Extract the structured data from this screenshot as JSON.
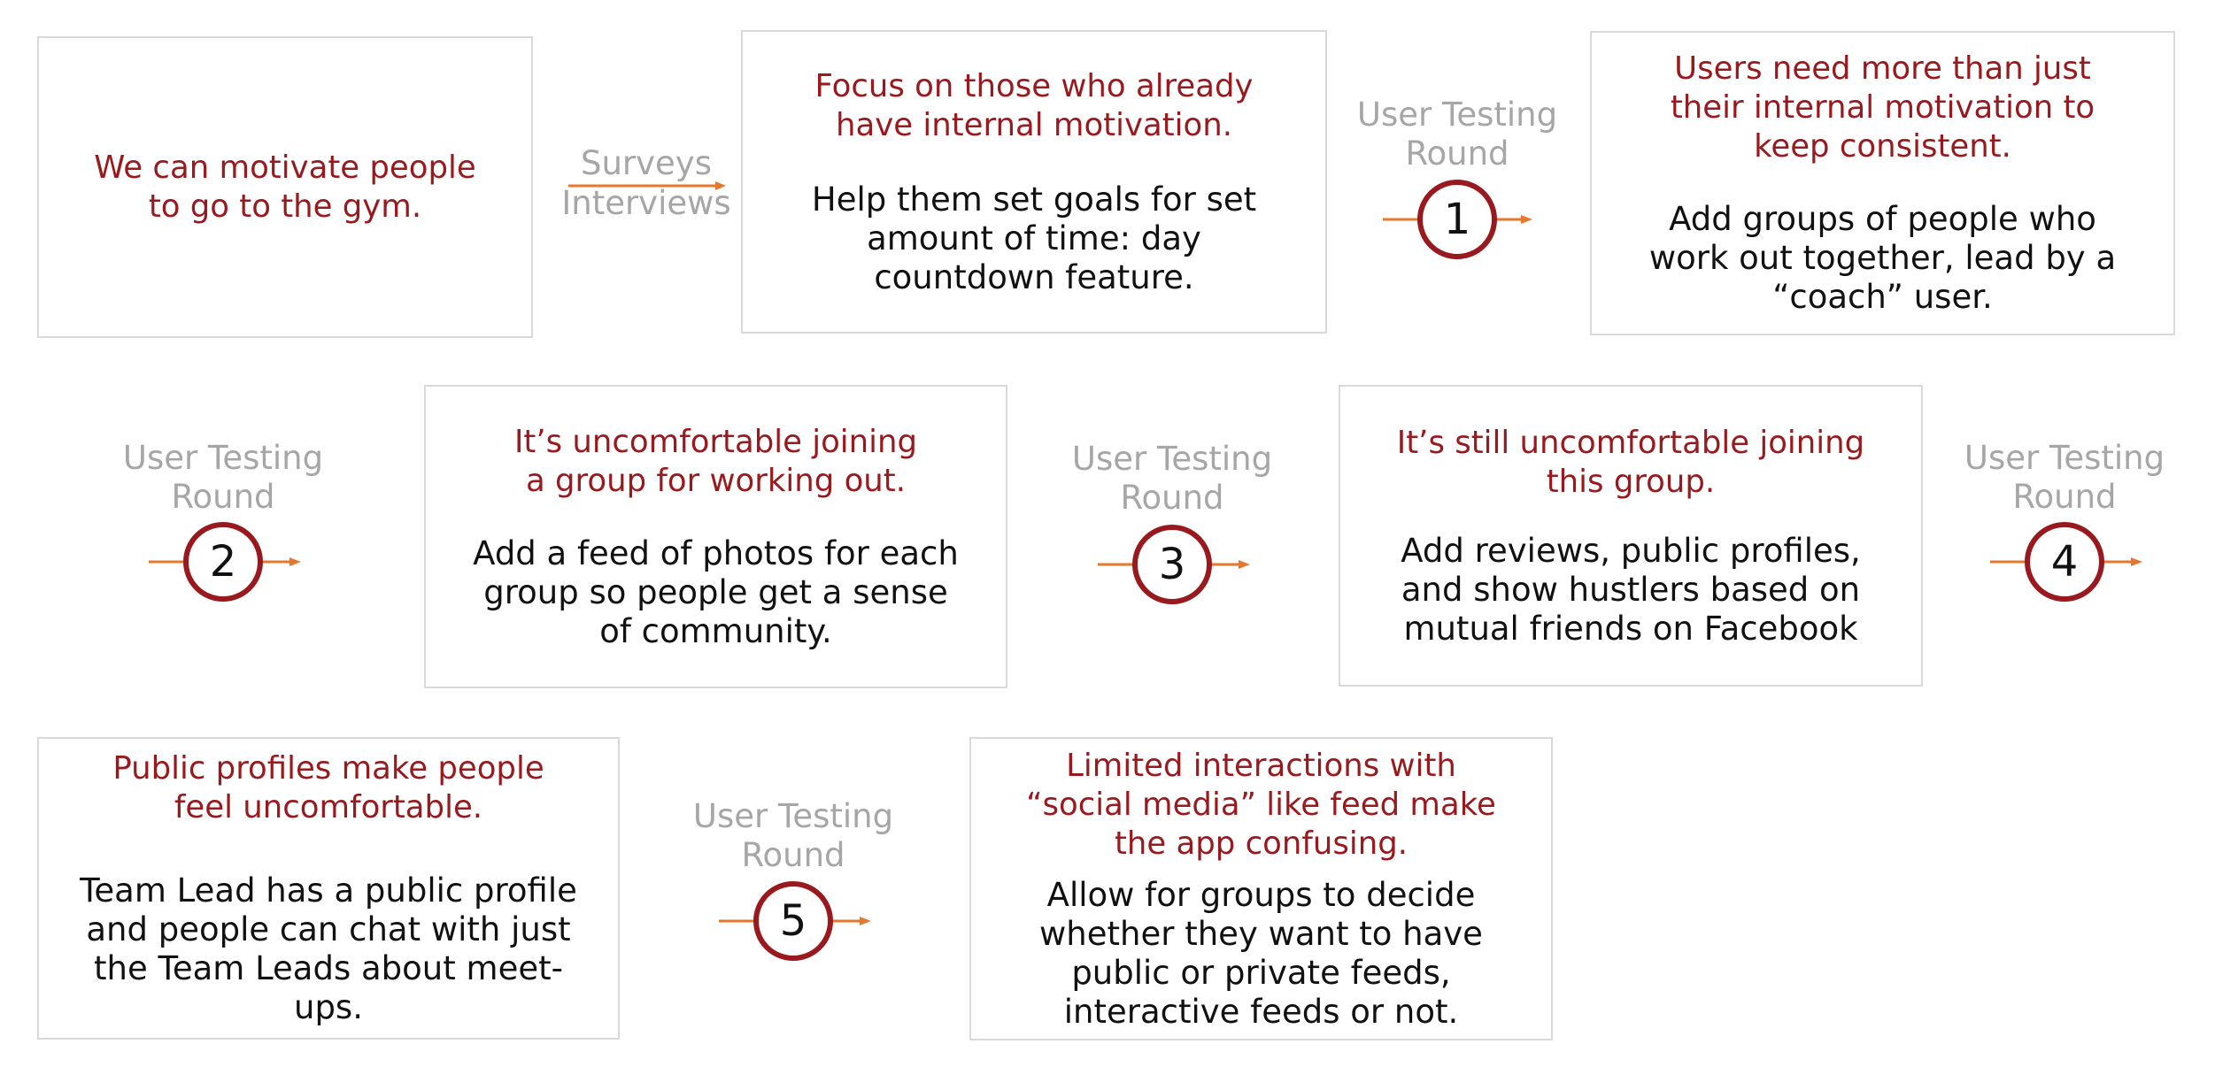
{
  "start": {
    "text": "We can motivate people to go to the gym."
  },
  "first_link": {
    "line1": "Surveys",
    "line2": "Interviews"
  },
  "boxes": [
    {
      "finding": "Focus on those who already have internal motivation.",
      "solution": "Help them set goals for set amount of time: day countdown feature."
    },
    {
      "finding": "Users need more than just their internal motivation to keep consistent.",
      "solution": "Add groups of people who work out together, lead by a “coach” user."
    },
    {
      "finding": "It’s uncomfortable joining a group for working out.",
      "solution": "Add a feed of photos for each group so people get a sense of community."
    },
    {
      "finding": "It’s still uncomfortable joining this group.",
      "solution": "Add reviews, public profiles, and show hustlers based on mutual friends on Facebook"
    },
    {
      "finding": "Public profiles make people feel uncomfortable.",
      "solution": "Team Lead has a public profile and people can chat with just the Team Leads about meet-ups."
    },
    {
      "finding": "Limited interactions with “social media” like feed make the app confusing.",
      "solution": "Allow for groups to decide whether they want to have public or private feeds, interactive feeds or not."
    }
  ],
  "rounds": [
    {
      "line1": "User Testing",
      "line2": "Round",
      "number": "1"
    },
    {
      "line1": "User Testing",
      "line2": "Round",
      "number": "2"
    },
    {
      "line1": "User Testing",
      "line2": "Round",
      "number": "3"
    },
    {
      "line1": "User Testing",
      "line2": "Round",
      "number": "4"
    },
    {
      "line1": "User Testing",
      "line2": "Round",
      "number": "5"
    }
  ],
  "colors": {
    "accent": "#991a1e",
    "arrow": "#e8772e",
    "muted": "#a6a6a6",
    "border": "#d9d9d9"
  }
}
